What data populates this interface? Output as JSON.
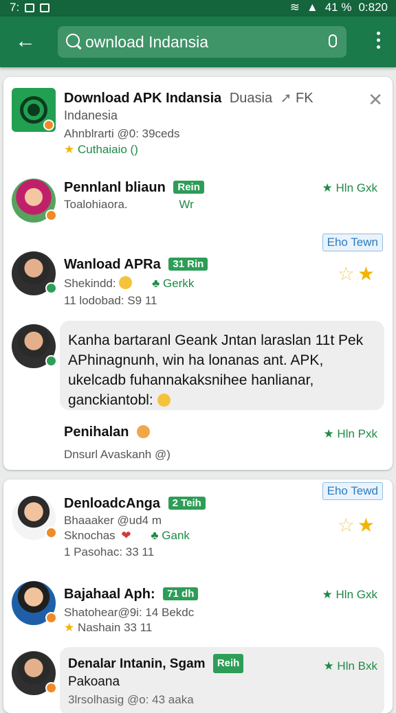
{
  "status_bar": {
    "left_text": "7:",
    "right_text": "41 %",
    "time": "0:820"
  },
  "search": {
    "query": "ownload Indansia"
  },
  "card1": {
    "header": {
      "title": "Download APK Indansia",
      "title_suffix": "Duasia",
      "title_extra": "FK",
      "line2": "Indanesia",
      "line3": "Ahnblrarti @0: 39ceds",
      "line4": "Cuthaiaio ()"
    },
    "entries": [
      {
        "name": "Pennlanl bliaun",
        "tag": "Rein",
        "sub": "Toalohiaora.",
        "sub2": "Wr",
        "meta": "Hln Gxk"
      },
      {
        "name": "Wanload APRa",
        "tag": "31 Rin",
        "sub": "Shekindd:",
        "sub_tag": "Gerkk",
        "sub2": "11 lodobad: S9 11",
        "chip": "Eho Tewn"
      },
      {
        "bubble_lines": [
          "Kanha bartaranl Geank Jntan laraslan 11t Pek",
          "APhinagnunh, win ha lonanas ant. APK,",
          "ukelcadb fuhannakaksnihee hanlianar,",
          "ganckiantobl:"
        ]
      },
      {
        "name": "Penihalan",
        "sub": "Dnsurl Avaskanh @)",
        "meta": "Hln Pxk"
      }
    ]
  },
  "card2": {
    "chip": "Eho Tewd",
    "entries": [
      {
        "name": "DenloadcAnga",
        "tag": "2 Teih",
        "line2": "Bhaaaker @ud4 m",
        "line3": "Sknochas",
        "line3_tag": "Gank",
        "line4": "1 Pasohac: 33 11"
      },
      {
        "name": "Bajahaal Aph:",
        "tag": "71 dh",
        "line2": "Shatohear@9i: 14 Bekdc",
        "line3": "Nashain 33 11",
        "meta": "Hln Gxk"
      },
      {
        "name": "Denalar Intanin, Sgam",
        "tag": "Reih",
        "line2": "Pakoana",
        "line3": "3lrsolhasig @o: 43 aaka",
        "meta": "Hln Bxk"
      }
    ]
  }
}
